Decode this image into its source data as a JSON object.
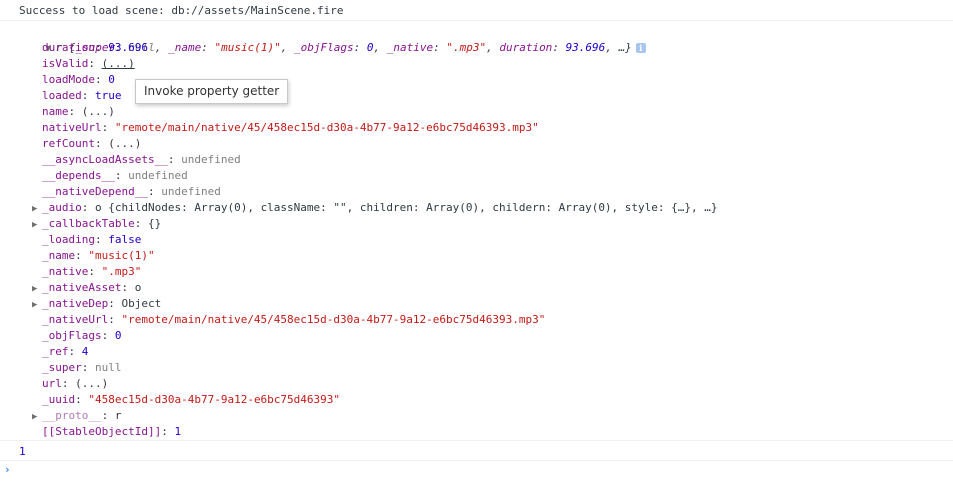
{
  "log": {
    "success_text": "Success to load scene: db://assets/MainScene.fire"
  },
  "object": {
    "class_name": "r",
    "preview": {
      "open": "{",
      "super_key": "_super",
      "super_val": "null",
      "name_key": "_name",
      "name_val": "\"music(1)\"",
      "objflags_key": "_objFlags",
      "objflags_val": "0",
      "native_key": "_native",
      "native_val": "\".mp3\"",
      "duration_key": "duration",
      "duration_val": "93.696",
      "ellipsis": "…}",
      "info_icon": "i"
    },
    "props": [
      {
        "key": "duration",
        "sep": ": ",
        "val": "93.696",
        "type": "n",
        "expandable": false,
        "dim": false
      },
      {
        "key": "isValid",
        "sep": ": ",
        "val": "(...)",
        "type": "plain",
        "expandable": false,
        "dim": false
      },
      {
        "key": "loadMode",
        "sep": ": ",
        "val": "0",
        "type": "n",
        "expandable": false,
        "dim": false
      },
      {
        "key": "loaded",
        "sep": ": ",
        "val": "true",
        "type": "n",
        "expandable": false,
        "dim": false
      },
      {
        "key": "name",
        "sep": ": ",
        "val": "(...)",
        "type": "plain",
        "expandable": false,
        "dim": false
      },
      {
        "key": "nativeUrl",
        "sep": ": ",
        "val": "\"remote/main/native/45/458ec15d-d30a-4b77-9a12-e6bc75d46393.mp3\"",
        "type": "s",
        "expandable": false,
        "dim": false
      },
      {
        "key": "refCount",
        "sep": ": ",
        "val": "(...)",
        "type": "plain",
        "expandable": false,
        "dim": false
      },
      {
        "key": "__asyncLoadAssets__",
        "sep": ": ",
        "val": "undefined",
        "type": "gray",
        "expandable": false,
        "dim": false
      },
      {
        "key": "__depends__",
        "sep": ": ",
        "val": "undefined",
        "type": "gray",
        "expandable": false,
        "dim": false
      },
      {
        "key": "__nativeDepend__",
        "sep": ": ",
        "val": "undefined",
        "type": "gray",
        "expandable": false,
        "dim": false
      },
      {
        "key": "_audio",
        "sep": ": ",
        "val": "o {childNodes: Array(0), className: \"\", children: Array(0), childern: Array(0), style: {…}, …}",
        "type": "plain",
        "expandable": true,
        "dim": false
      },
      {
        "key": "_callbackTable",
        "sep": ": ",
        "val": "{}",
        "type": "plain",
        "expandable": true,
        "dim": false
      },
      {
        "key": "_loading",
        "sep": ": ",
        "val": "false",
        "type": "n",
        "expandable": false,
        "dim": false
      },
      {
        "key": "_name",
        "sep": ": ",
        "val": "\"music(1)\"",
        "type": "s",
        "expandable": false,
        "dim": false
      },
      {
        "key": "_native",
        "sep": ": ",
        "val": "\".mp3\"",
        "type": "s",
        "expandable": false,
        "dim": false
      },
      {
        "key": "_nativeAsset",
        "sep": ": ",
        "val": "o",
        "type": "plain",
        "expandable": true,
        "dim": false
      },
      {
        "key": "_nativeDep",
        "sep": ": ",
        "val": "Object",
        "type": "plain",
        "expandable": true,
        "dim": false
      },
      {
        "key": "_nativeUrl",
        "sep": ": ",
        "val": "\"remote/main/native/45/458ec15d-d30a-4b77-9a12-e6bc75d46393.mp3\"",
        "type": "s",
        "expandable": false,
        "dim": false
      },
      {
        "key": "_objFlags",
        "sep": ": ",
        "val": "0",
        "type": "n",
        "expandable": false,
        "dim": false
      },
      {
        "key": "_ref",
        "sep": ": ",
        "val": "4",
        "type": "n",
        "expandable": false,
        "dim": false
      },
      {
        "key": "_super",
        "sep": ": ",
        "val": "null",
        "type": "gray",
        "expandable": false,
        "dim": false
      },
      {
        "key": "url",
        "sep": ": ",
        "val": "(...)",
        "type": "plain",
        "expandable": false,
        "dim": false
      },
      {
        "key": "_uuid",
        "sep": ": ",
        "val": "\"458ec15d-d30a-4b77-9a12-e6bc75d46393\"",
        "type": "s",
        "expandable": false,
        "dim": false
      },
      {
        "key": "__proto__",
        "sep": ": ",
        "val": "r",
        "type": "plain",
        "expandable": true,
        "dim": true
      },
      {
        "key": "[[StableObjectId]]",
        "sep": ": ",
        "val": "1",
        "type": "n",
        "expandable": false,
        "dim": false
      }
    ]
  },
  "tooltip": {
    "text": "Invoke property getter"
  },
  "result": {
    "value": "1"
  },
  "prompt": {
    "symbol": "›",
    "value": ""
  },
  "colors": {
    "key": "#881391",
    "string": "#c41a16",
    "number": "#1c00cf",
    "prompt": "#3a7ff6"
  }
}
